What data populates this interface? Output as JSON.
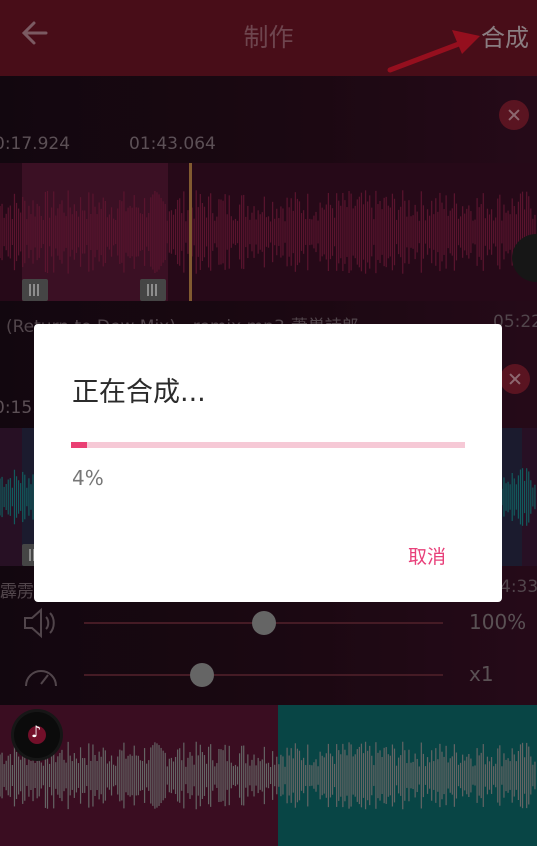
{
  "header": {
    "title": "制作",
    "compose_label": "合成"
  },
  "track1": {
    "time_start": "0:17.924",
    "time_mid": "01:43.064",
    "name": "(Return to Dew Mix) - remix.mp3-蕭巣詩郎",
    "duration": "05:22"
  },
  "track2": {
    "time_start": "0:15.1",
    "name": "霹雳",
    "duration": "4:33"
  },
  "controls": {
    "volume_value": "100%",
    "speed_value": "x1",
    "volume_level": 0.5,
    "speed_level": 0.33
  },
  "dialog": {
    "title": "正在合成...",
    "progress_label": "4%",
    "progress": 0.04,
    "cancel_label": "取消"
  },
  "colors": {
    "accent": "#ea3f73",
    "topbar": "#6f1425"
  }
}
